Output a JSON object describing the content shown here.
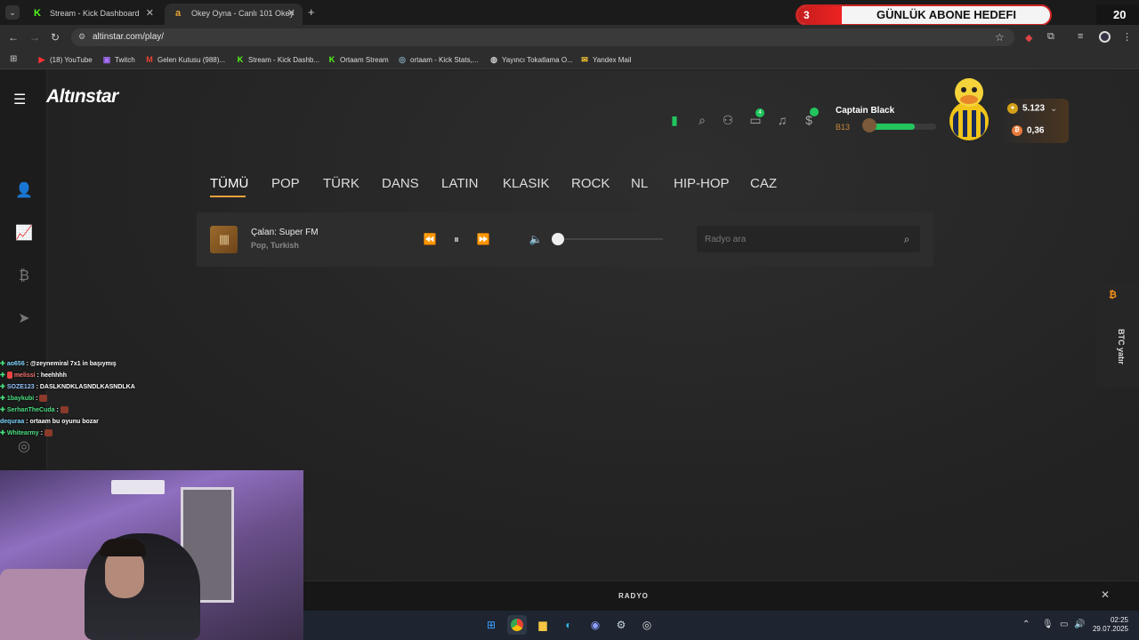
{
  "browser": {
    "tabs": [
      {
        "label": "Stream - Kick Dashboard",
        "active": false
      },
      {
        "label": "Okey Oyna - Canlı 101 Okey",
        "active": true
      }
    ],
    "url": "altinstar.com/play/",
    "bookmarks": [
      "(18) YouTube",
      "Twitch",
      "Gelen Kutusu (988)...",
      "Stream - Kick Dashb...",
      "Ortaam Stream",
      "ortaam - Kick Stats,...",
      "Yayıncı Tokatlama O...",
      "Yandex Mail"
    ]
  },
  "stream_overlay": {
    "goal_count": "3",
    "goal_label": "GÜNLÜK ABONE HEDEFI",
    "goal_target": "20"
  },
  "site": {
    "logo": "Altınstar",
    "user": {
      "name": "Captain Black",
      "level": "B13",
      "xp_fraction": 0.68
    },
    "chat_badge": "4",
    "balances": {
      "gold": "5.123",
      "btc": "0,36"
    },
    "categories": [
      "TÜMÜ",
      "POP",
      "TÜRK",
      "DANS",
      "LATIN",
      "KLASIK",
      "ROCK",
      "NL",
      "HIP-HOP",
      "CAZ"
    ],
    "active_category": "TÜMÜ",
    "player": {
      "now_playing": "Çalan: Super FM",
      "genre": "Pop, Turkish",
      "volume": 0.0,
      "search_placeholder": "Radyo ara"
    },
    "btc_deposit": "BTC yatır",
    "radio_bar_label": "RADYO"
  },
  "chat": [
    {
      "user": "ao656",
      "msg": "@zeynemiral 7x1 in başıymış",
      "color": "#7dd3fc"
    },
    {
      "user": "melissi",
      "msg": "heehhhh",
      "color": "#f87171"
    },
    {
      "user": "SOZE123",
      "msg": "DASLKNDKLASNDLKASNDLKA",
      "color": "#93c5fd"
    },
    {
      "user": "1baykubi",
      "msg": "",
      "color": "#4ade80"
    },
    {
      "user": "SerhanTheCuda",
      "msg": "",
      "color": "#4ade80"
    },
    {
      "user": "dequraa",
      "msg": "ortaam bu oyunu bozar",
      "color": "#7dd3fc"
    },
    {
      "user": "Whitearmy",
      "msg": "",
      "color": "#4ade80"
    }
  ],
  "taskbar": {
    "time": "02:25",
    "date": "29.07.2025"
  }
}
